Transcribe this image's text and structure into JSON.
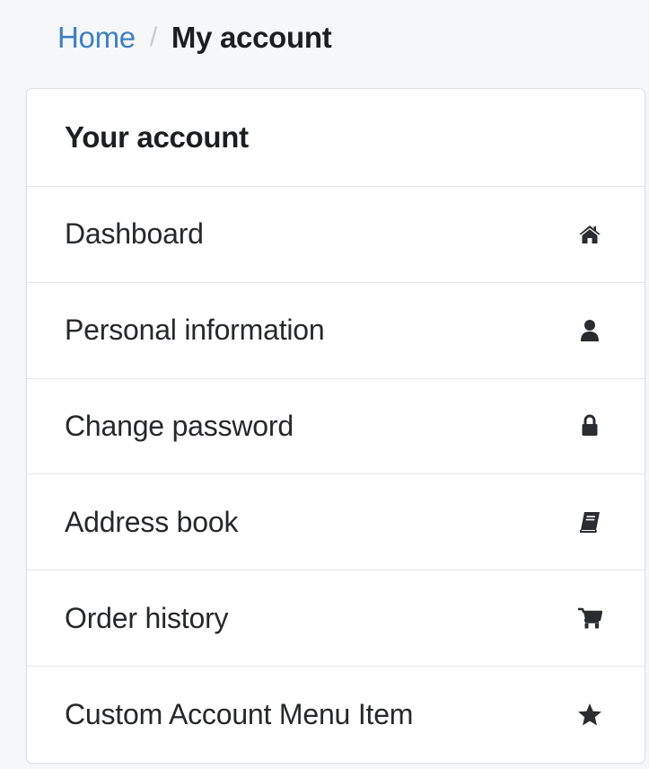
{
  "breadcrumb": {
    "home": "Home",
    "separator": "/",
    "current": "My account"
  },
  "account": {
    "header": "Your account",
    "items": [
      {
        "label": "Dashboard",
        "icon": "home-icon"
      },
      {
        "label": "Personal information",
        "icon": "user-icon"
      },
      {
        "label": "Change password",
        "icon": "lock-icon"
      },
      {
        "label": "Address book",
        "icon": "book-icon"
      },
      {
        "label": "Order history",
        "icon": "cart-icon"
      },
      {
        "label": "Custom Account Menu Item",
        "icon": "star-icon"
      }
    ]
  },
  "colors": {
    "link": "#3f7fc4",
    "text": "#26282c",
    "border": "#e3e5e8",
    "background": "#f6f7f9"
  }
}
